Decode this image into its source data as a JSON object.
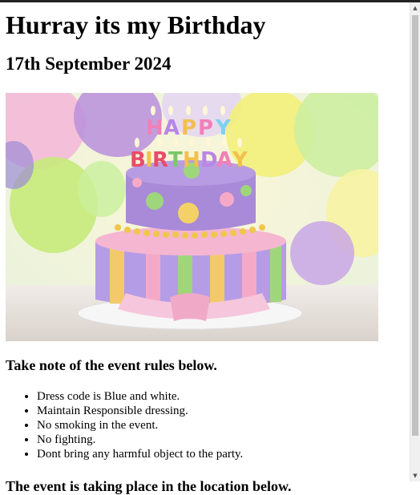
{
  "heading": "Hurray its my Birthday",
  "date": "17th September 2024",
  "cake_image": {
    "alt": "Birthday cake with Happy Birthday candles",
    "candle_top": "HAPPY",
    "candle_bottom": "BIRTHDAY"
  },
  "rules_title": "Take note of the event rules below.",
  "rules": [
    "Dress code is Blue and white.",
    "Maintain Responsible dressing.",
    "No smoking in the event.",
    "No fighting.",
    "Dont bring any harmful object to the party."
  ],
  "clipped_text": "The event is taking place in the location below.",
  "scrollbar": {
    "up_icon": "triangle-up",
    "down_icon": "triangle-down"
  }
}
